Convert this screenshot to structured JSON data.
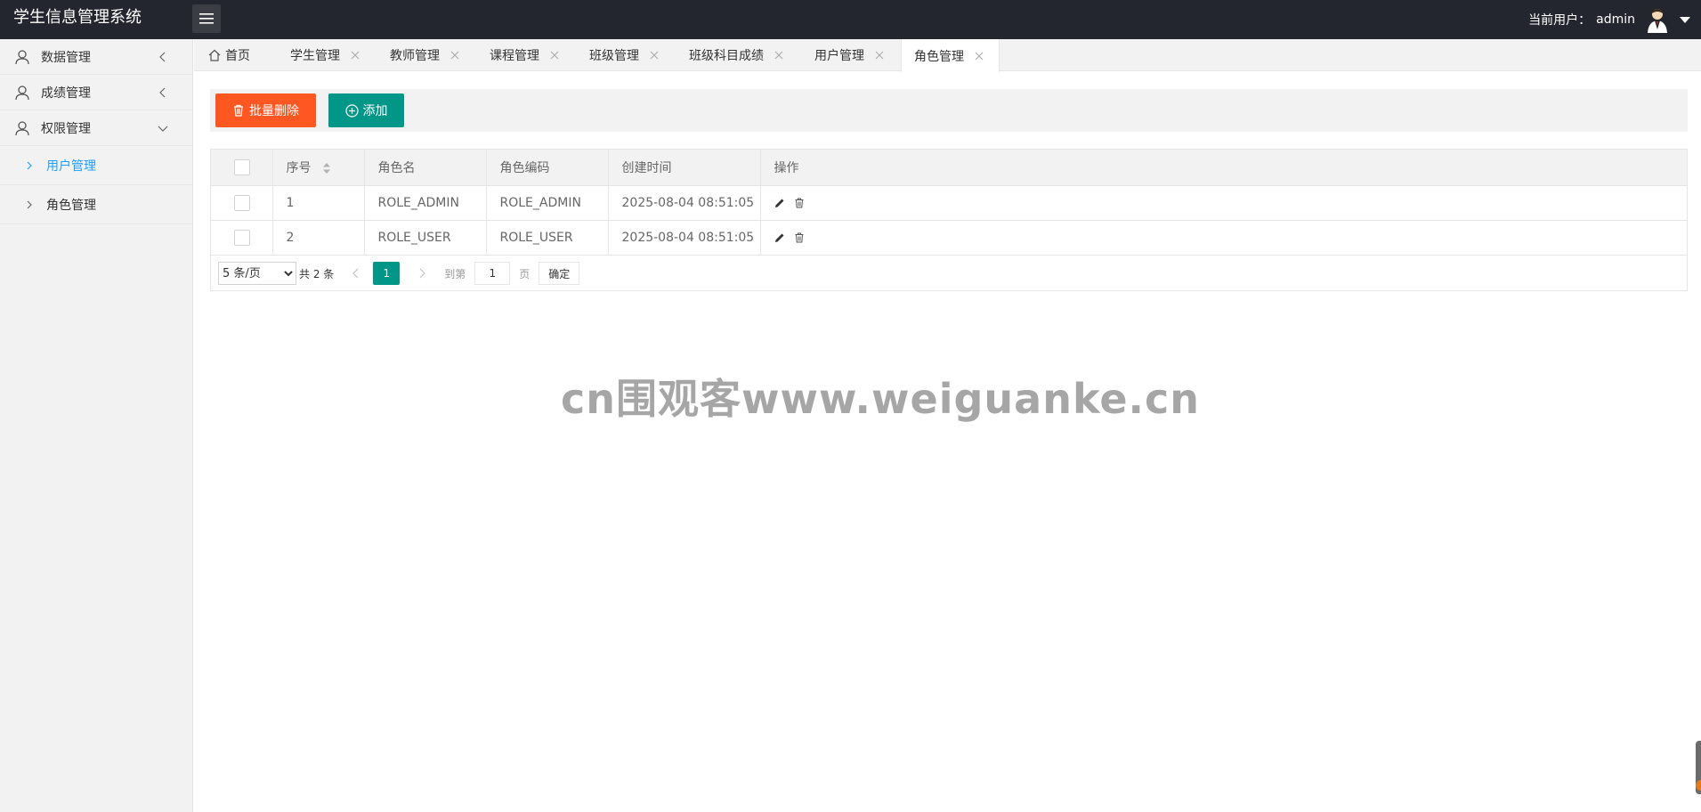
{
  "app": {
    "title": "学生信息管理系统"
  },
  "header": {
    "current_user_label": "当前用户：",
    "username": "admin"
  },
  "sidebar": {
    "groups": [
      {
        "label": "数据管理"
      },
      {
        "label": "成绩管理"
      },
      {
        "label": "权限管理"
      }
    ],
    "sub_items": [
      {
        "label": "用户管理",
        "active": true
      },
      {
        "label": "角色管理",
        "active": false
      }
    ]
  },
  "tabs": [
    {
      "label": "首页"
    },
    {
      "label": "学生管理"
    },
    {
      "label": "教师管理"
    },
    {
      "label": "课程管理"
    },
    {
      "label": "班级管理"
    },
    {
      "label": "班级科目成绩"
    },
    {
      "label": "用户管理"
    },
    {
      "label": "角色管理",
      "active": true
    }
  ],
  "toolbar": {
    "batch_delete_label": "批量删除",
    "add_label": "添加"
  },
  "table": {
    "columns": [
      "序号",
      "角色名",
      "角色编码",
      "创建时间",
      "操作"
    ],
    "rows": [
      {
        "index": "1",
        "name": "ROLE_ADMIN",
        "code": "ROLE_ADMIN",
        "created": "2025-08-04 08:51:05"
      },
      {
        "index": "2",
        "name": "ROLE_USER",
        "code": "ROLE_USER",
        "created": "2025-08-04 08:51:05"
      }
    ]
  },
  "pager": {
    "page_size_option": "5 条/页",
    "total_text": "共 2 条",
    "current_page": "1",
    "goto_label": "到第",
    "goto_value": "1",
    "page_unit": "页",
    "confirm_label": "确定"
  },
  "watermark": "cn围观客www.weiguanke.cn",
  "colors": {
    "header_bg": "#23262e",
    "danger": "#ff5722",
    "primary": "#009688",
    "active_link": "#1e9fff"
  }
}
